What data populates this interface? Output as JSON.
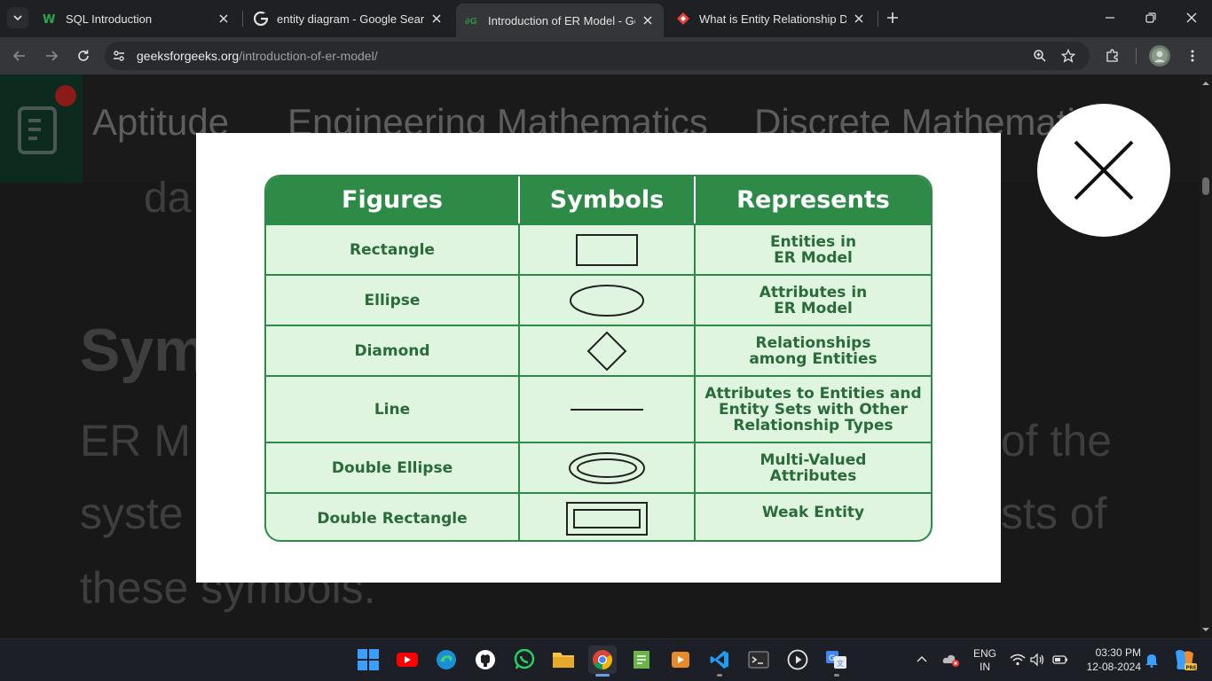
{
  "browser": {
    "tabs": [
      {
        "label": "SQL Introduction",
        "icon": "w-icon",
        "active": false
      },
      {
        "label": "entity diagram - Google Search",
        "icon": "google-icon",
        "active": false
      },
      {
        "label": "Introduction of ER Model - Gee",
        "icon": "gfg-icon",
        "active": true
      },
      {
        "label": "What is Entity Relationship Diag",
        "icon": "diamond-icon",
        "active": false
      }
    ],
    "url_host": "geeksforgeeks.org",
    "url_path": "/introduction-of-er-model/"
  },
  "page": {
    "nav_items": [
      "Aptitude",
      "Engineering Mathematics",
      "Discrete Mathemati"
    ],
    "bg_fragments": {
      "frag1": "da",
      "frag2": "Sym",
      "frag3": "ER M",
      "frag4": "syste",
      "frag5": "these symbols.",
      "frag6": "of the",
      "frag7": "sts of"
    }
  },
  "table": {
    "headers": [
      "Figures",
      "Symbols",
      "Represents"
    ],
    "rows": [
      {
        "figure": "Rectangle",
        "symbol": "rectangle-symbol",
        "represents": "Entities in\nER Model"
      },
      {
        "figure": "Ellipse",
        "symbol": "ellipse-symbol",
        "represents": "Attributes in\nER Model"
      },
      {
        "figure": "Diamond",
        "symbol": "diamond-symbol",
        "represents": "Relationships\namong Entities"
      },
      {
        "figure": "Line",
        "symbol": "line-symbol",
        "represents": "Attributes to Entities and\nEntity Sets with Other\nRelationship Types"
      },
      {
        "figure": "Double Ellipse",
        "symbol": "double-ellipse-symbol",
        "represents": "Multi-Valued\nAttributes"
      },
      {
        "figure": "Double Rectangle",
        "symbol": "double-rectangle-symbol",
        "represents": "Weak Entity"
      }
    ]
  },
  "taskbar": {
    "lang_top": "ENG",
    "lang_bottom": "IN",
    "time": "03:30 PM",
    "date": "12-08-2024"
  },
  "colors": {
    "gfg_green": "#2e8b47",
    "cell_bg": "#dff5df",
    "text_green": "#2a6b3a"
  }
}
